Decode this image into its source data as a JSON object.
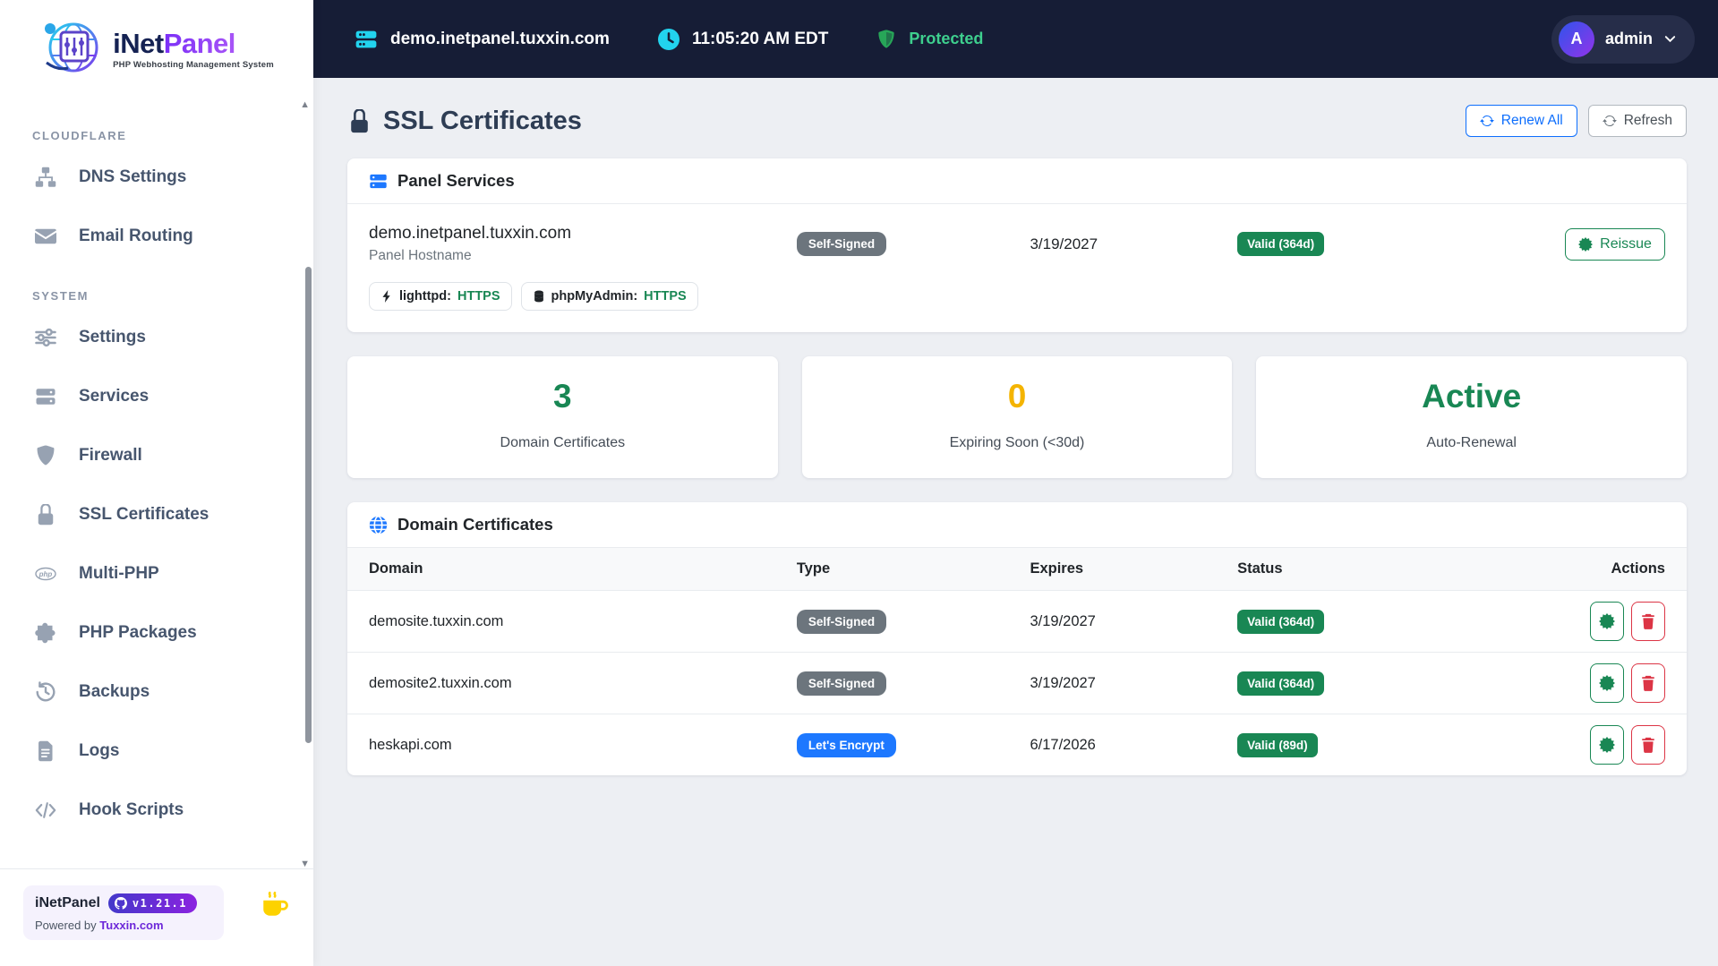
{
  "brand": {
    "name_primary": "iNet",
    "name_secondary": "Panel",
    "tagline": "PHP Webhosting Management System"
  },
  "topbar": {
    "hostname": "demo.inetpanel.tuxxin.com",
    "time": "11:05:20 AM EDT",
    "protection_status": "Protected",
    "user": {
      "initial": "A",
      "name": "admin"
    }
  },
  "sidebar": {
    "sections": [
      {
        "label": "CLOUDFLARE",
        "items": [
          {
            "label": "DNS Settings",
            "icon": "sitemap-icon"
          },
          {
            "label": "Email Routing",
            "icon": "envelope-icon"
          }
        ]
      },
      {
        "label": "SYSTEM",
        "items": [
          {
            "label": "Settings",
            "icon": "sliders-icon"
          },
          {
            "label": "Services",
            "icon": "server-icon"
          },
          {
            "label": "Firewall",
            "icon": "shield-icon"
          },
          {
            "label": "SSL Certificates",
            "icon": "lock-icon"
          },
          {
            "label": "Multi-PHP",
            "icon": "php-icon"
          },
          {
            "label": "PHP Packages",
            "icon": "puzzle-icon"
          },
          {
            "label": "Backups",
            "icon": "history-icon"
          },
          {
            "label": "Logs",
            "icon": "file-icon"
          },
          {
            "label": "Hook Scripts",
            "icon": "code-icon"
          }
        ]
      }
    ]
  },
  "page": {
    "title": "SSL Certificates",
    "renew_all_label": "Renew All",
    "refresh_label": "Refresh"
  },
  "panel_services": {
    "title": "Panel Services",
    "hostname": "demo.inetpanel.tuxxin.com",
    "hostname_label": "Panel Hostname",
    "type_badge": "Self-Signed",
    "expires": "3/19/2027",
    "status_badge": "Valid (364d)",
    "reissue_label": "Reissue",
    "service_tags": [
      {
        "icon": "bolt-icon",
        "name": "lighttpd:",
        "value": "HTTPS"
      },
      {
        "icon": "database-icon",
        "name": "phpMyAdmin:",
        "value": "HTTPS"
      }
    ]
  },
  "stats": [
    {
      "value": "3",
      "label": "Domain Certificates",
      "color": "#198754"
    },
    {
      "value": "0",
      "label": "Expiring Soon (<30d)",
      "color": "#f4b400"
    },
    {
      "value": "Active",
      "label": "Auto-Renewal",
      "color": "#198754"
    }
  ],
  "domain_table": {
    "title": "Domain Certificates",
    "columns": [
      "Domain",
      "Type",
      "Expires",
      "Status",
      "Actions"
    ],
    "rows": [
      {
        "domain": "demosite.tuxxin.com",
        "type": "Self-Signed",
        "expires": "3/19/2027",
        "status": "Valid (364d)"
      },
      {
        "domain": "demosite2.tuxxin.com",
        "type": "Self-Signed",
        "expires": "3/19/2027",
        "status": "Valid (364d)"
      },
      {
        "domain": "heskapi.com",
        "type": "Let's Encrypt",
        "expires": "6/17/2026",
        "status": "Valid (89d)"
      }
    ]
  },
  "footer": {
    "app_name": "iNetPanel",
    "version": "v1.21.1",
    "powered_by": "Powered by",
    "powered_link": "Tuxxin.com"
  },
  "colors": {
    "topbar_bg": "#161d36",
    "cyan_icon": "#22d3ee",
    "protected_green": "#3ecf8e",
    "accent_blue": "#0d6efd",
    "success_green": "#198754",
    "warning_yellow": "#f4b400",
    "self_signed_gray": "#6c757d",
    "lets_encrypt_blue": "#1d78ff",
    "danger_red": "#dc3545",
    "brand_purple": "#7c3aed"
  }
}
